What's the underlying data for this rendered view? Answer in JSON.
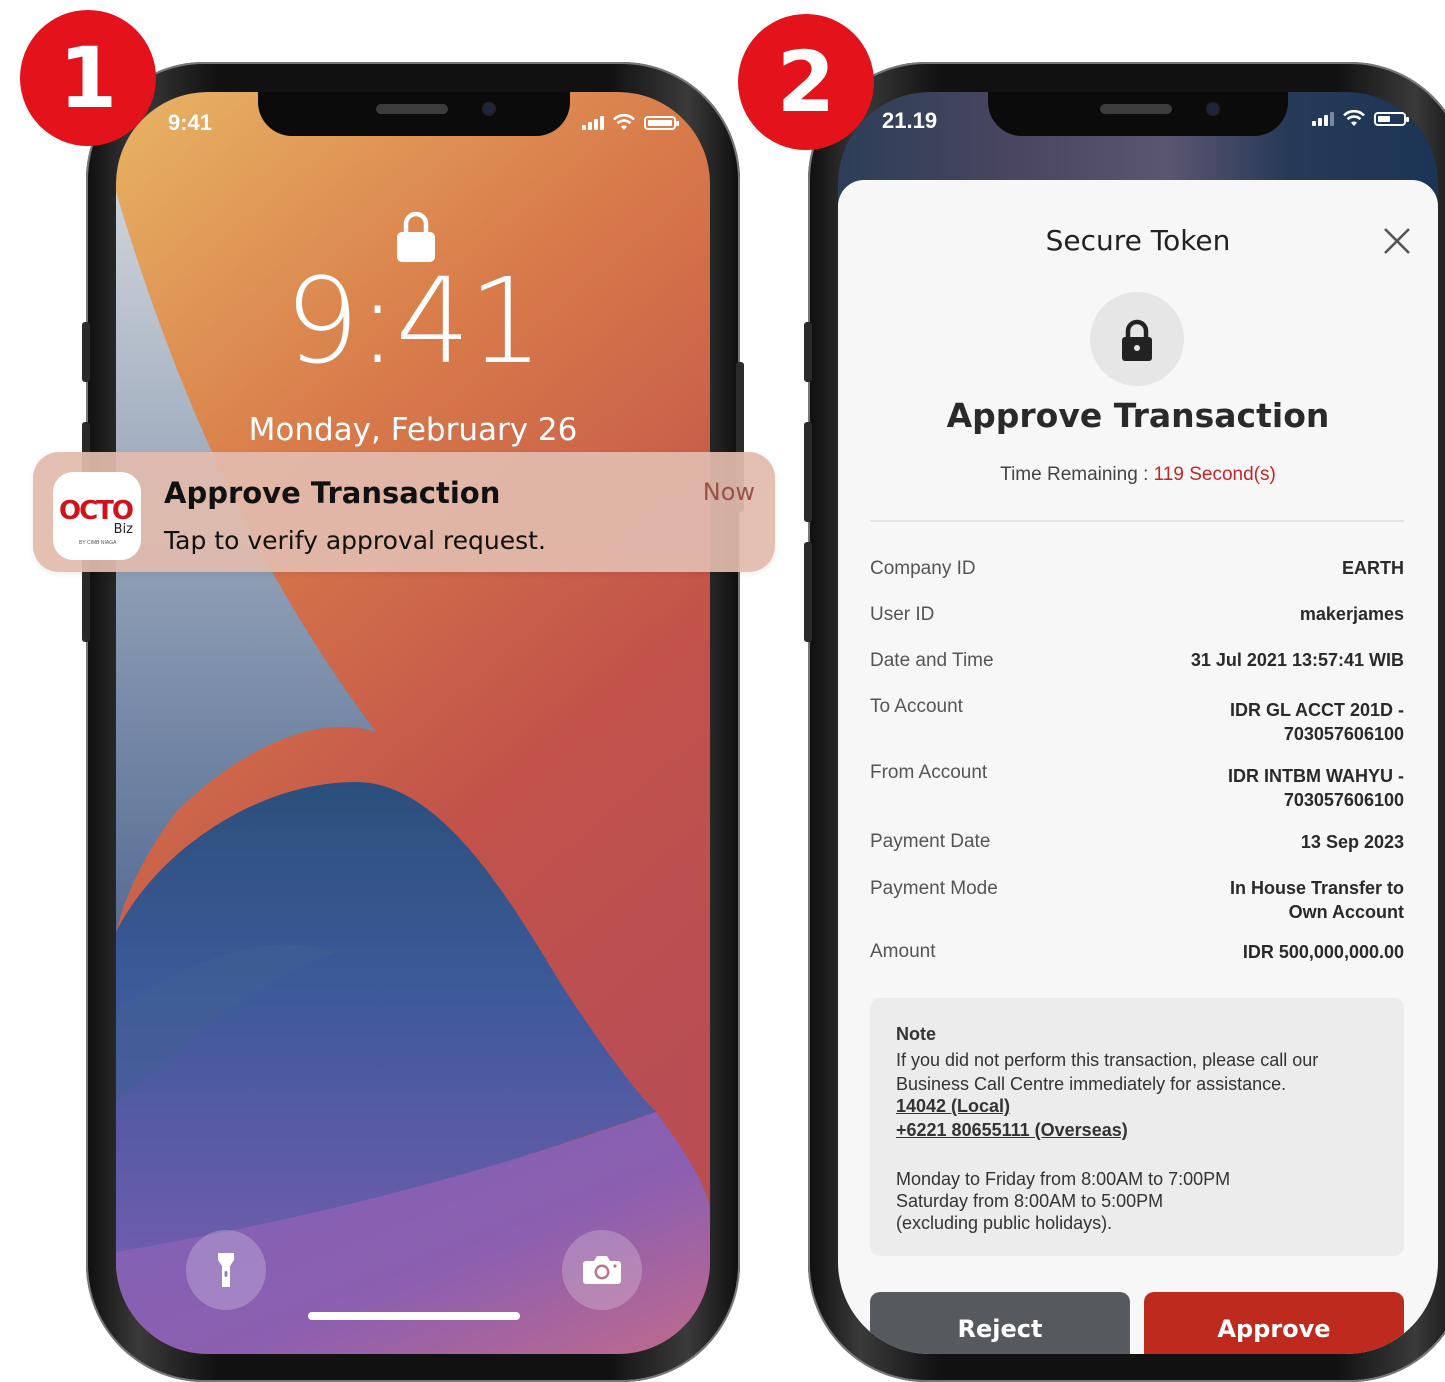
{
  "steps": {
    "one": "1",
    "two": "2"
  },
  "lockscreen": {
    "status_time": "9:41",
    "time": "9:41",
    "date": "Monday, February 26"
  },
  "notification": {
    "app_logo": "OCTO",
    "app_logo_sub": "Biz",
    "app_logo_byline": "BY CIMB NIAGA",
    "title": "Approve Transaction",
    "body": "Tap to verify approval request.",
    "time": "Now"
  },
  "app": {
    "status_time": "21.19",
    "header": "Secure Token",
    "title": "Approve Transaction",
    "time_remaining_label": "Time Remaining : ",
    "time_remaining_value": "119 Second(s)",
    "details": [
      {
        "label": "Company ID",
        "value": "EARTH"
      },
      {
        "label": "User ID",
        "value": "makerjames"
      },
      {
        "label": "Date and Time",
        "value": "31 Jul 2021 13:57:41 WIB"
      },
      {
        "label": "To Account",
        "value": "IDR GL ACCT 201D - 703057606100"
      },
      {
        "label": "From Account",
        "value": "IDR INTBM WAHYU - 703057606100"
      },
      {
        "label": "Payment Date",
        "value": "13 Sep 2023"
      },
      {
        "label": "Payment Mode",
        "value": "In House Transfer to Own Account"
      },
      {
        "label": "Amount",
        "value": "IDR 500,000,000.00"
      }
    ],
    "note": {
      "title": "Note",
      "text": "If you did not perform this transaction, please call our Business Call Centre immediately for assistance.",
      "phone_local": "14042 (Local)",
      "phone_overseas": "+6221 80655111 (Overseas)",
      "hours_1": "Monday to Friday from 8:00AM to 7:00PM",
      "hours_2": "Saturday from 8:00AM to 5:00PM",
      "hours_3": "(excluding public holidays)."
    },
    "reject_label": "Reject",
    "approve_label": "Approve"
  },
  "colors": {
    "badge": "#e3121b",
    "approve": "#bf2a1f",
    "reject": "#565a5e",
    "accent_red": "#c0282b"
  }
}
